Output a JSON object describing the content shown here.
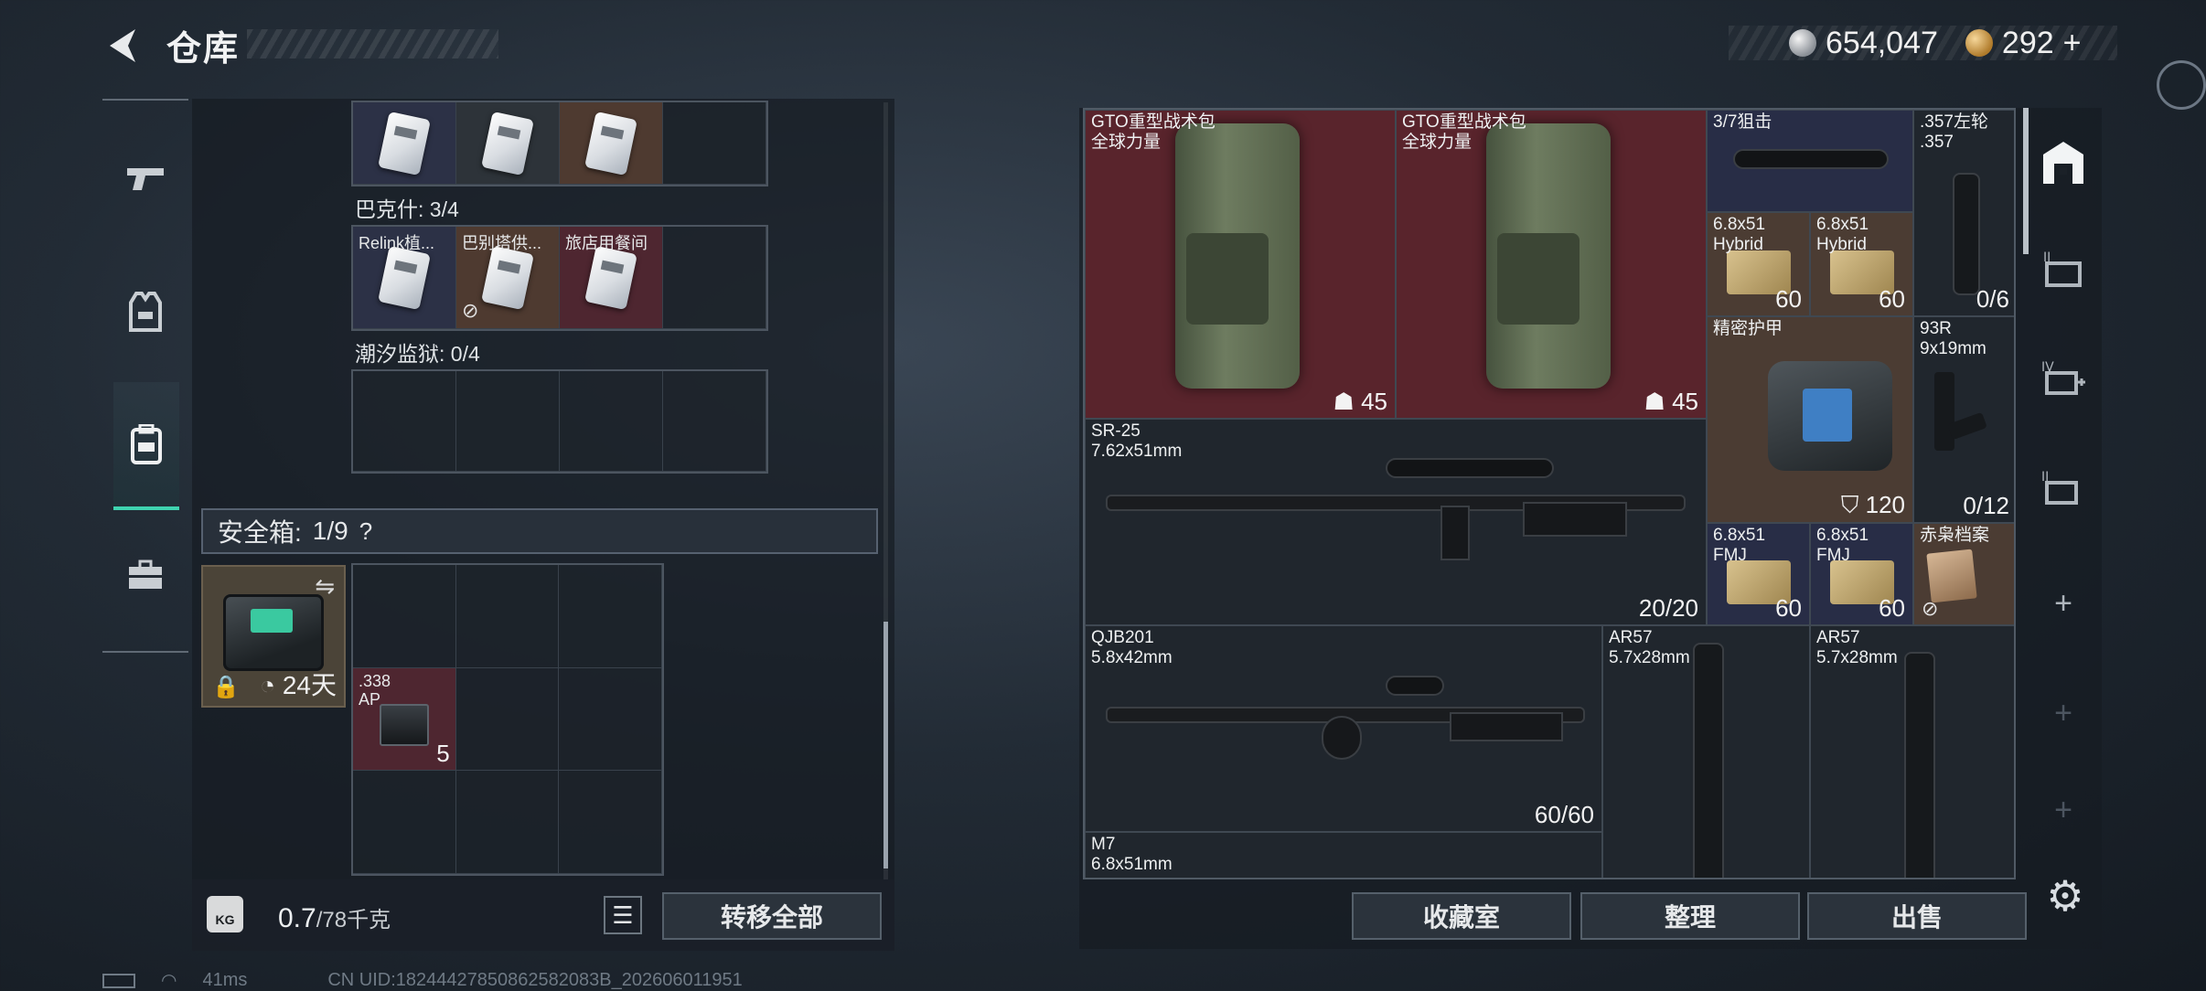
{
  "header": {
    "title": "仓库",
    "silver_amount": "654,047",
    "gold_amount": "292",
    "gold_plus": "+"
  },
  "left_nav": {
    "items": [
      {
        "name": "weapons",
        "icon": "pistol-icon"
      },
      {
        "name": "armor",
        "icon": "vest-icon"
      },
      {
        "name": "backpack",
        "icon": "backpack-icon",
        "active": true
      },
      {
        "name": "toolbox",
        "icon": "toolbox-icon"
      }
    ]
  },
  "keycards": {
    "row1_labels": [
      "",
      "",
      "",
      ""
    ],
    "section2_label": "巴克什: 3/4",
    "row2_labels": [
      "Relink植...",
      "巴别塔供...",
      "旅店用餐间",
      ""
    ],
    "section3_label": "潮汐监狱: 0/4"
  },
  "safebox": {
    "label": "安全箱: ",
    "count": "1/9",
    "help": "?",
    "time_left": "24天",
    "ammo_label": ".338\nAP",
    "ammo_count": "5"
  },
  "weight": {
    "icon_text": "KG",
    "current": "0.7",
    "max": "/78千克"
  },
  "buttons": {
    "transfer_all": "转移全部",
    "collection": "收藏室",
    "sort": "整理",
    "sell": "出售"
  },
  "status": {
    "ping": "41ms",
    "uid": "CN UID:18244427850862582083B_202606011951"
  },
  "stash": {
    "backpack1_name": "GTO重型战术包\n全球力量",
    "backpack1_val": "45",
    "backpack2_name": "GTO重型战术包\n全球力量",
    "backpack2_val": "45",
    "scope_name": "3/7狙击",
    "revolver_name": ".357左轮\n.357",
    "revolver_count": "0/6",
    "ammo1_name": "6.8x51\nHybrid",
    "ammo1_count": "60",
    "ammo2_name": "6.8x51\nHybrid",
    "ammo2_count": "60",
    "armor_name": "精密护甲",
    "armor_val": "120",
    "pistol_name": "93R\n9x19mm",
    "pistol_count": "0/12",
    "sr25_name": "SR-25\n7.62x51mm",
    "sr25_count": "20/20",
    "ammo3_name": "6.8x51\nFMJ",
    "ammo3_count": "60",
    "ammo4_name": "6.8x51\nFMJ",
    "ammo4_count": "60",
    "file_name": "赤枭档案",
    "qjb_name": "QJB201\n5.8x42mm",
    "qjb_count": "60/60",
    "ar57a_name": "AR57\n5.7x28mm",
    "ar57b_name": "AR57\n5.7x28mm",
    "m7_name": "M7\n6.8x51mm"
  },
  "colors": {
    "accent_teal": "#3fd4b0",
    "red_rarity": "#59242c",
    "blue_rarity": "#282d46",
    "tan_rarity": "#4b3c33"
  }
}
